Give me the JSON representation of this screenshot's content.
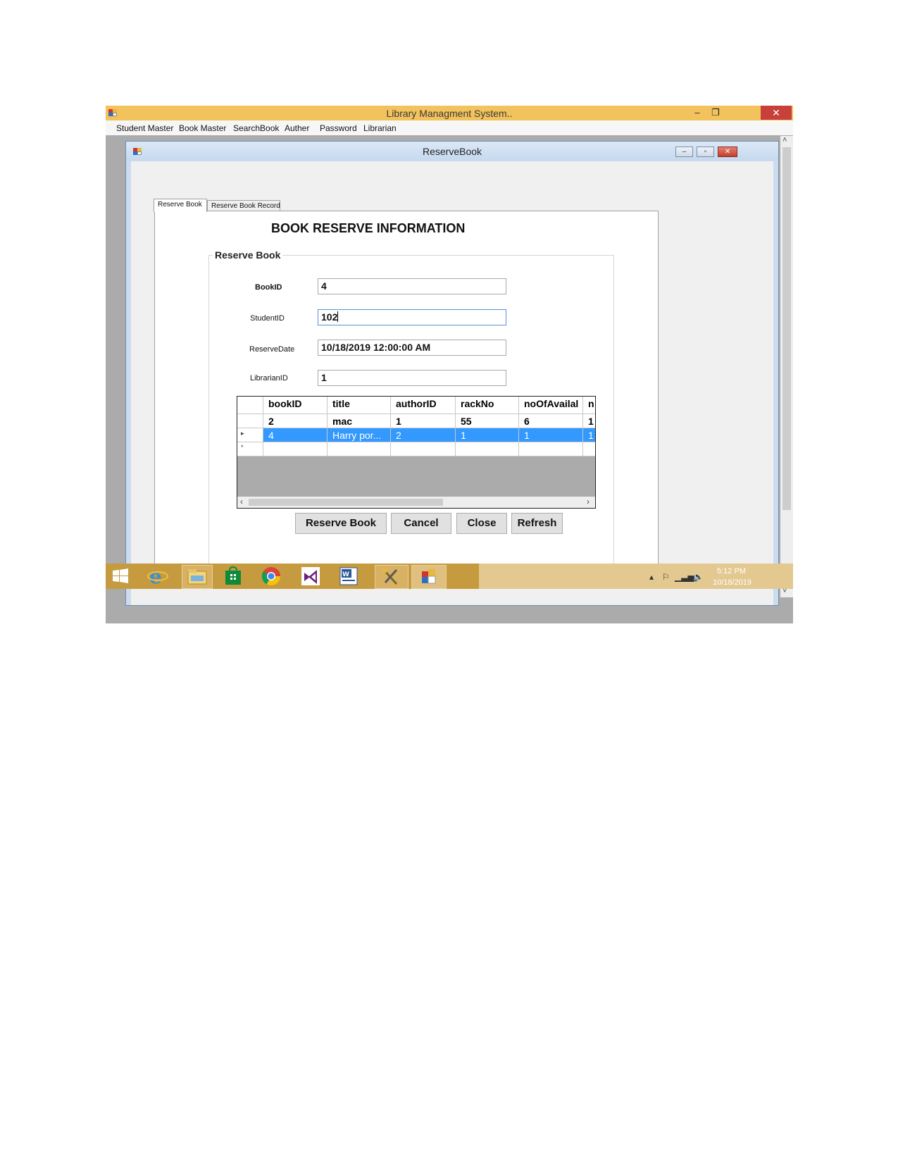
{
  "main_window": {
    "title": "Library Managment System..",
    "controls": {
      "minimize": "‒",
      "restore": "❐",
      "close": "✕"
    }
  },
  "menu": {
    "items": [
      "Student Master",
      "Book Master",
      "SearchBook",
      "Auther",
      "Password",
      "Librarian"
    ]
  },
  "child_window": {
    "title": "ReserveBook",
    "controls": {
      "minimize": "–",
      "restore": "▫",
      "close": "✕"
    }
  },
  "tabs": [
    {
      "label": "Reserve Book",
      "active": true
    },
    {
      "label": "Reserve Book Record",
      "active": false
    }
  ],
  "form": {
    "heading": "BOOK RESERVE INFORMATION",
    "group_title": "Reserve Book",
    "fields": [
      {
        "label": "BookID",
        "value": "4"
      },
      {
        "label": "StudentID",
        "value": "102"
      },
      {
        "label": "ReserveDate",
        "value": "10/18/2019 12:00:00 AM"
      },
      {
        "label": "LibrarianID",
        "value": "1"
      }
    ]
  },
  "grid": {
    "columns": [
      "bookID",
      "title",
      "authorID",
      "rackNo",
      "noOfAvailal",
      "n"
    ],
    "rows": [
      {
        "marker": "",
        "cells": [
          "2",
          "mac",
          "1",
          "55",
          "6",
          "1"
        ],
        "selected": false
      },
      {
        "marker": "▸",
        "cells": [
          "4",
          "Harry por...",
          "2",
          "1",
          "1",
          "1"
        ],
        "selected": true
      },
      {
        "marker": "*",
        "cells": [
          "",
          "",
          "",
          "",
          "",
          ""
        ],
        "selected": false
      }
    ],
    "scroll_left": "‹",
    "scroll_right": "›"
  },
  "buttons": {
    "reserve": "Reserve Book",
    "cancel": "Cancel",
    "close": "Close",
    "refresh": "Refresh"
  },
  "taskbar": {
    "icons": [
      "windows-start-icon",
      "internet-explorer-icon",
      "file-explorer-icon",
      "store-icon",
      "chrome-icon",
      "visual-studio-icon",
      "word-icon",
      "tools-icon",
      "library-app-icon"
    ],
    "clock_time": "5:12 PM",
    "clock_date": "10/18/2019"
  },
  "colors": {
    "main_titlebar": "#f2c25c",
    "taskbar": "#c69a3e",
    "grid_selection": "#3399ff",
    "child_titlebar": "#cbdcee"
  }
}
